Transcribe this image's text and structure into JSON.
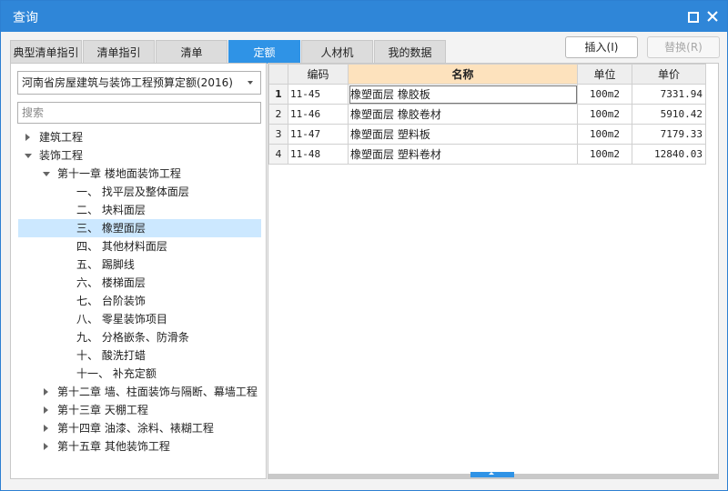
{
  "window": {
    "title": "查询"
  },
  "tabs": [
    {
      "label": "典型清单指引",
      "active": false
    },
    {
      "label": "清单指引",
      "active": false
    },
    {
      "label": "清单",
      "active": false
    },
    {
      "label": "定额",
      "active": true
    },
    {
      "label": "人材机",
      "active": false
    },
    {
      "label": "我的数据",
      "active": false
    }
  ],
  "actions": {
    "insert_label": "插入(I)",
    "replace_label": "替换(R)",
    "replace_enabled": false
  },
  "quota_select": {
    "value": "河南省房屋建筑与装饰工程预算定额(2016)"
  },
  "search": {
    "placeholder": "搜索",
    "value": ""
  },
  "tree": [
    {
      "label": "建筑工程",
      "expanded": false,
      "selected": false
    },
    {
      "label": "装饰工程",
      "expanded": true,
      "selected": false
    },
    {
      "label": "第十一章 楼地面装饰工程",
      "expanded": true,
      "selected": false
    },
    {
      "label": "一、  找平层及整体面层",
      "selected": false
    },
    {
      "label": "二、  块料面层",
      "selected": false
    },
    {
      "label": "三、  橡塑面层",
      "selected": true
    },
    {
      "label": "四、  其他材料面层",
      "selected": false
    },
    {
      "label": "五、  踢脚线",
      "selected": false
    },
    {
      "label": "六、  楼梯面层",
      "selected": false
    },
    {
      "label": "七、  台阶装饰",
      "selected": false
    },
    {
      "label": "八、  零星装饰项目",
      "selected": false
    },
    {
      "label": "九、  分格嵌条、防滑条",
      "selected": false
    },
    {
      "label": "十、  酸洗打蜡",
      "selected": false
    },
    {
      "label": "十一、  补充定额",
      "selected": false
    },
    {
      "label": "第十二章 墙、柱面装饰与隔断、幕墙工程",
      "expanded": false,
      "selected": false
    },
    {
      "label": "第十三章 天棚工程",
      "expanded": false,
      "selected": false
    },
    {
      "label": "第十四章 油漆、涂料、裱糊工程",
      "expanded": false,
      "selected": false
    },
    {
      "label": "第十五章 其他装饰工程",
      "expanded": false,
      "selected": false
    }
  ],
  "table": {
    "columns": [
      "编码",
      "名称",
      "单位",
      "单价"
    ],
    "rows": [
      {
        "n": "1",
        "code": "11-45",
        "name": "橡塑面层 橡胶板",
        "unit": "100m2",
        "price": "7331.94"
      },
      {
        "n": "2",
        "code": "11-46",
        "name": "橡塑面层 橡胶卷材",
        "unit": "100m2",
        "price": "5910.42"
      },
      {
        "n": "3",
        "code": "11-47",
        "name": "橡塑面层 塑料板",
        "unit": "100m2",
        "price": "7179.33"
      },
      {
        "n": "4",
        "code": "11-48",
        "name": "橡塑面层 塑料卷材",
        "unit": "100m2",
        "price": "12840.03"
      }
    ]
  },
  "colors": {
    "titlebar": "#2f86d8",
    "active_tab": "#2f93e6",
    "selected_row": "#cce8ff",
    "name_header": "#fde2bd"
  }
}
